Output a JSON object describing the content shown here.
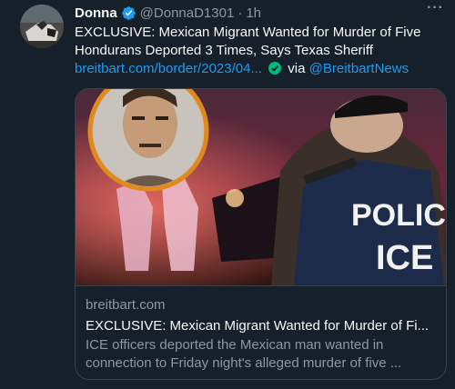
{
  "tweet": {
    "display_name": "Donna",
    "handle": "@DonnaD1301",
    "separator": "·",
    "time": "1h",
    "more": "···",
    "text": "EXCLUSIVE: Mexican Migrant Wanted for Murder of Five Hondurans Deported 3 Times, Says Texas Sheriff",
    "link": "breitbart.com/border/2023/04...",
    "via_label": "via",
    "via_handle": "@BreitbartNews"
  },
  "card": {
    "image_vest_text_line1": "POLICE",
    "image_vest_text_line2": "ICE",
    "domain": "breitbart.com",
    "title": "EXCLUSIVE: Mexican Migrant Wanted for Murder of Fi...",
    "description_line1": "ICE officers deported the Mexican man wanted in",
    "description_line2": "connection to Friday night's alleged murder of five ..."
  },
  "colors": {
    "background": "#15202b",
    "link": "#1d9bf0",
    "secondary_text": "#8b98a5",
    "verified_blue": "#1d9bf0",
    "verified_green": "#00ba7c"
  },
  "icons": {
    "verified": "verified-badge-icon",
    "link_check": "verified-check-icon",
    "more": "more-options-icon"
  }
}
